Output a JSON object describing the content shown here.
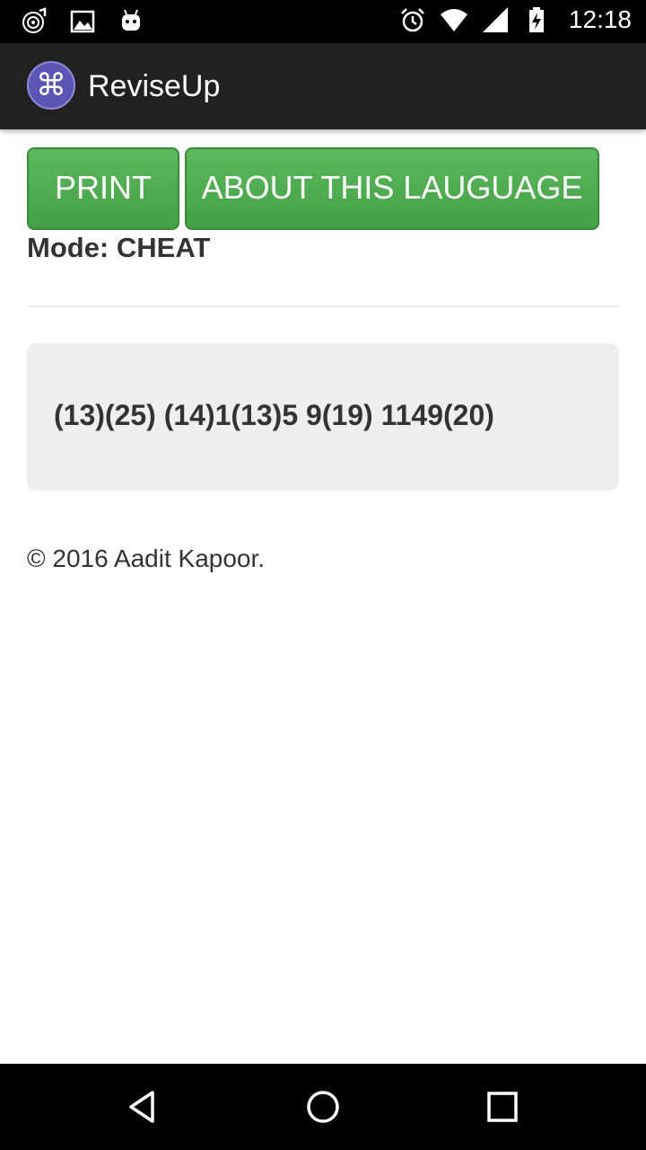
{
  "status_bar": {
    "time": "12:18",
    "left_icons": [
      "music-sync-icon",
      "image-icon",
      "android-icon"
    ],
    "right_icons": [
      "alarm-icon",
      "wifi-icon",
      "cell-signal-icon",
      "battery-charging-icon"
    ]
  },
  "action_bar": {
    "app_icon": "command-key-icon",
    "app_icon_glyph": "⌘",
    "title": "ReviseUp",
    "background": "#212121",
    "icon_color": "#5c55b3"
  },
  "buttons": {
    "print_label": "PRINT",
    "about_label": "ABOUT THIS LAUGUAGE",
    "color": "#5cb85c"
  },
  "mode_text": "Mode: CHEAT",
  "output": {
    "text": "(13)(25) (14)1(13)5 9(19) 1149(20)"
  },
  "footer": {
    "copyright": "© 2016 Aadit Kapoor."
  },
  "nav_bar": {
    "icons": [
      "back-icon",
      "home-icon",
      "recents-icon"
    ]
  }
}
